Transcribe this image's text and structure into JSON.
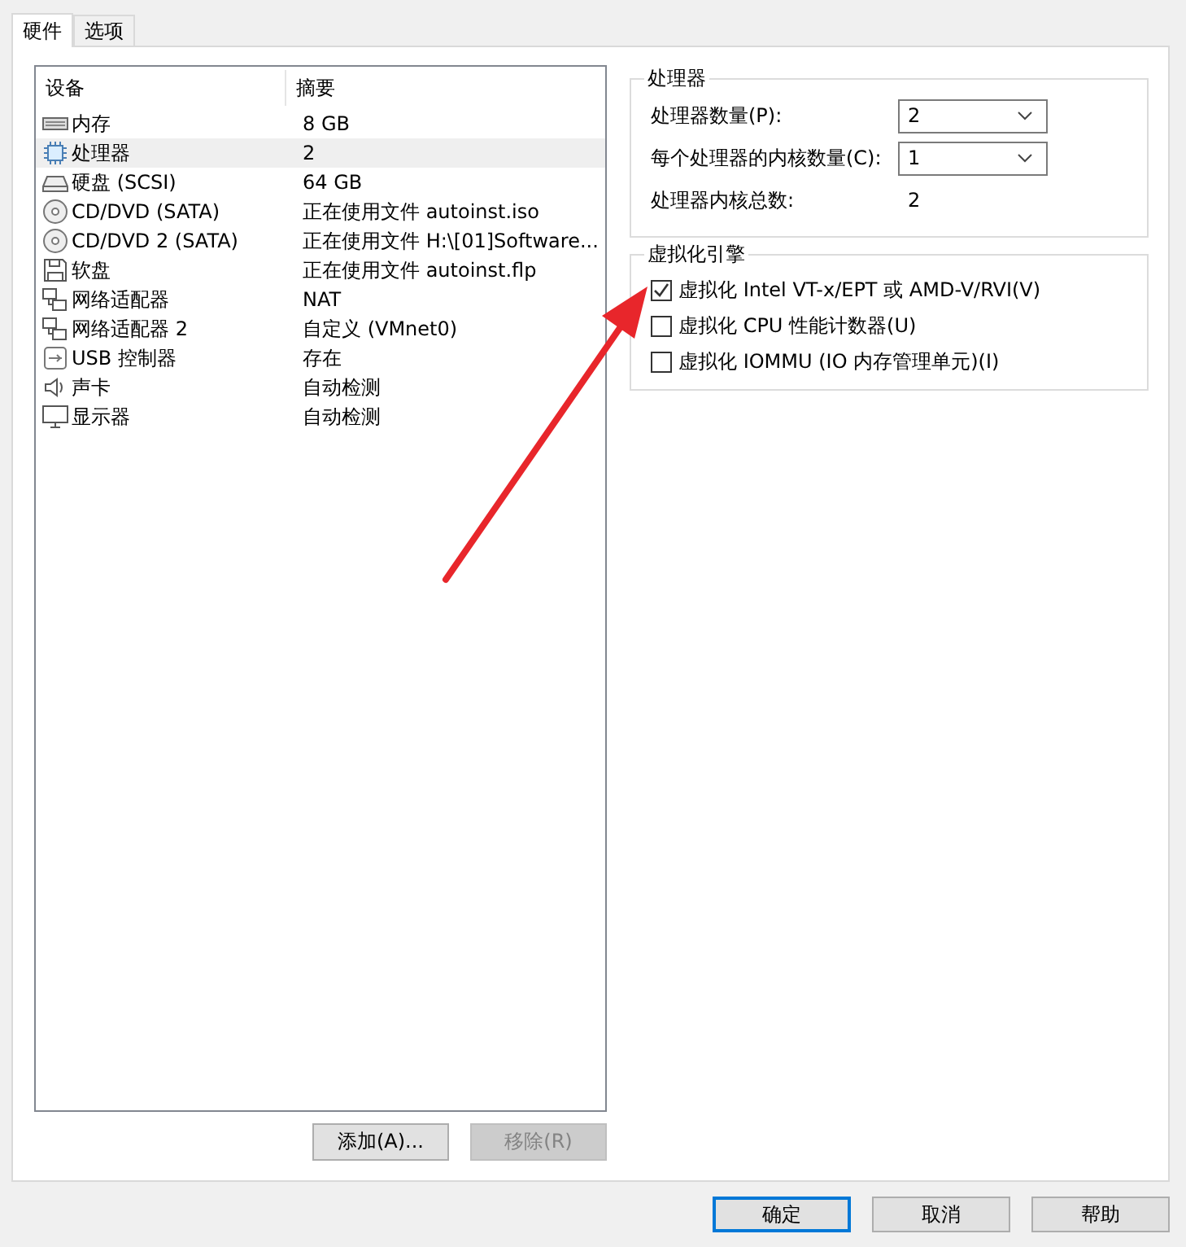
{
  "tabs": [
    {
      "label": "硬件",
      "selected": true
    },
    {
      "label": "选项",
      "selected": false
    }
  ],
  "devices": {
    "columns": [
      "设备",
      "摘要"
    ],
    "rows": [
      {
        "kind": "memory",
        "name": "内存",
        "summary": "8 GB",
        "selected": false
      },
      {
        "kind": "cpu",
        "name": "处理器",
        "summary": "2",
        "selected": true
      },
      {
        "kind": "disk",
        "name": "硬盘 (SCSI)",
        "summary": "64 GB",
        "selected": false
      },
      {
        "kind": "cd",
        "name": "CD/DVD (SATA)",
        "summary": "正在使用文件 autoinst.iso",
        "selected": false
      },
      {
        "kind": "cd",
        "name": "CD/DVD 2 (SATA)",
        "summary": "正在使用文件 H:\\[01]Software...",
        "selected": false
      },
      {
        "kind": "floppy",
        "name": "软盘",
        "summary": "正在使用文件 autoinst.flp",
        "selected": false
      },
      {
        "kind": "network",
        "name": "网络适配器",
        "summary": "NAT",
        "selected": false
      },
      {
        "kind": "network",
        "name": "网络适配器 2",
        "summary": "自定义 (VMnet0)",
        "selected": false
      },
      {
        "kind": "usb",
        "name": "USB 控制器",
        "summary": "存在",
        "selected": false
      },
      {
        "kind": "sound",
        "name": "声卡",
        "summary": "自动检测",
        "selected": false
      },
      {
        "kind": "display",
        "name": "显示器",
        "summary": "自动检测",
        "selected": false
      }
    ],
    "buttons": [
      {
        "label": "添加(A)...",
        "disabled": false
      },
      {
        "label": "移除(R)",
        "disabled": true
      }
    ]
  },
  "processor": {
    "title": "处理器",
    "fields": [
      {
        "label": "处理器数量(P):",
        "value": "2"
      },
      {
        "label": "每个处理器的内核数量(C):",
        "value": "1"
      }
    ],
    "total_label": "处理器内核总数:",
    "total_value": "2"
  },
  "virtualization": {
    "title": "虚拟化引擎",
    "options": [
      {
        "label": "虚拟化 Intel VT-x/EPT 或 AMD-V/RVI(V)",
        "checked": true
      },
      {
        "label": "虚拟化 CPU 性能计数器(U)",
        "checked": false
      },
      {
        "label": "虚拟化 IOMMU (IO 内存管理单元)(I)",
        "checked": false
      }
    ]
  },
  "footer_buttons": [
    {
      "label": "确定",
      "default": true
    },
    {
      "label": "取消",
      "default": false
    },
    {
      "label": "帮助",
      "default": false
    }
  ]
}
